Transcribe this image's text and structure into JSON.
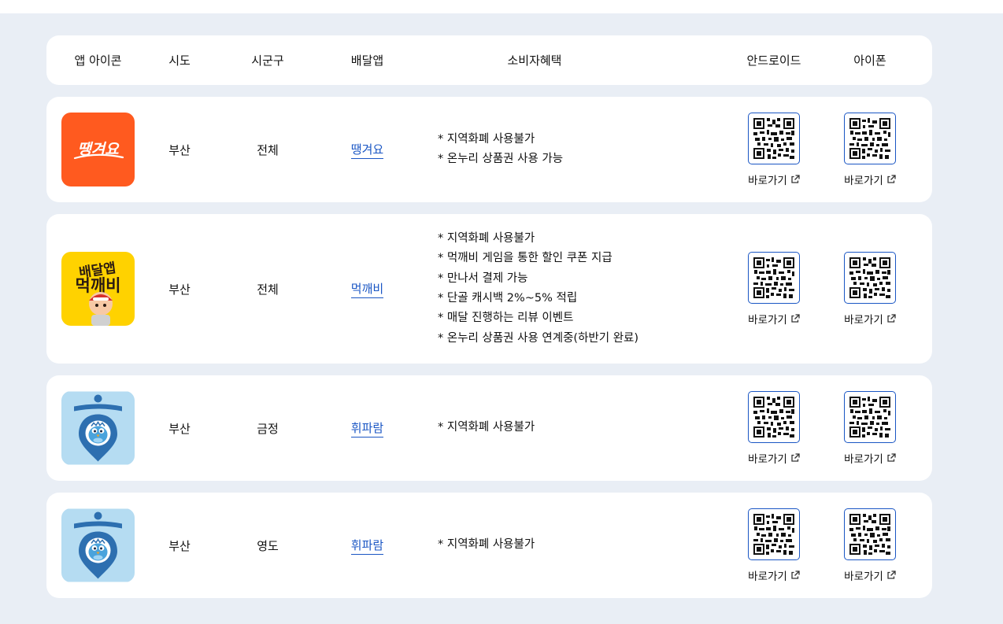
{
  "header": {
    "icon_col": "앱 아이콘",
    "sido_col": "시도",
    "sigungu_col": "시군구",
    "app_col": "배달앱",
    "benefit_col": "소비자혜택",
    "android_col": "안드로이드",
    "ios_col": "아이폰"
  },
  "rows": [
    {
      "sido": "부산",
      "sigungu": "전체",
      "app": "땡겨요",
      "icon_text": "땡겨요",
      "benefits": [
        "* 지역화폐 사용불가",
        "* 온누리 상품권 사용 가능"
      ],
      "android_link": "바로가기",
      "ios_link": "바로가기"
    },
    {
      "sido": "부산",
      "sigungu": "전체",
      "app": "먹깨비",
      "icon_text_top": "배달앱",
      "icon_text_bottom": "먹깨비",
      "benefits": [
        "* 지역화폐 사용불가",
        "* 먹깨비 게임을 통한 할인 쿠폰 지급",
        "* 만나서 결제 가능",
        "* 단골 캐시백 2%~5% 적립",
        "* 매달 진행하는 리뷰 이벤트",
        "* 온누리 상품권 사용 연계중(하반기 완료)"
      ],
      "android_link": "바로가기",
      "ios_link": "바로가기"
    },
    {
      "sido": "부산",
      "sigungu": "금정",
      "app": "휘파람",
      "benefits": [
        "* 지역화폐 사용불가"
      ],
      "android_link": "바로가기",
      "ios_link": "바로가기"
    },
    {
      "sido": "부산",
      "sigungu": "영도",
      "app": "휘파람",
      "benefits": [
        "* 지역화폐 사용불가"
      ],
      "android_link": "바로가기",
      "ios_link": "바로가기"
    }
  ],
  "icons": {
    "qr": "qr-code-icon",
    "external": "external-link-icon"
  },
  "colors": {
    "page_bg": "#e9eef5",
    "link": "#1a56c4",
    "ttaeng_orange": "#ff5a1f",
    "mukkaebi_yellow": "#ffd200",
    "whiparam_blue": "#b5dcf2"
  }
}
